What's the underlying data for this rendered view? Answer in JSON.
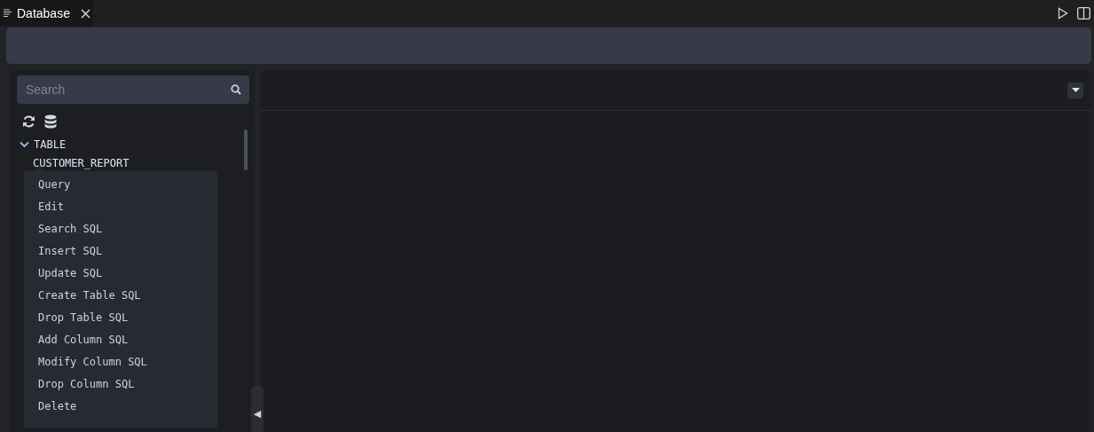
{
  "tab": {
    "title": "Database"
  },
  "search": {
    "placeholder": "Search"
  },
  "tree": [
    {
      "label": "TABLE",
      "expanded": true,
      "children": [
        {
          "label": "CUSTOMER_REPORT"
        }
      ]
    }
  ],
  "context_menu": [
    {
      "label": "Query"
    },
    {
      "label": "Edit"
    },
    {
      "label": "Search SQL"
    },
    {
      "label": "Insert SQL"
    },
    {
      "label": "Update SQL"
    },
    {
      "label": "Create Table SQL"
    },
    {
      "label": "Drop Table SQL"
    },
    {
      "label": "Add Column SQL"
    },
    {
      "label": "Modify Column SQL"
    },
    {
      "label": "Drop Column SQL"
    },
    {
      "label": "Delete"
    }
  ],
  "collapse_handle": "◀"
}
